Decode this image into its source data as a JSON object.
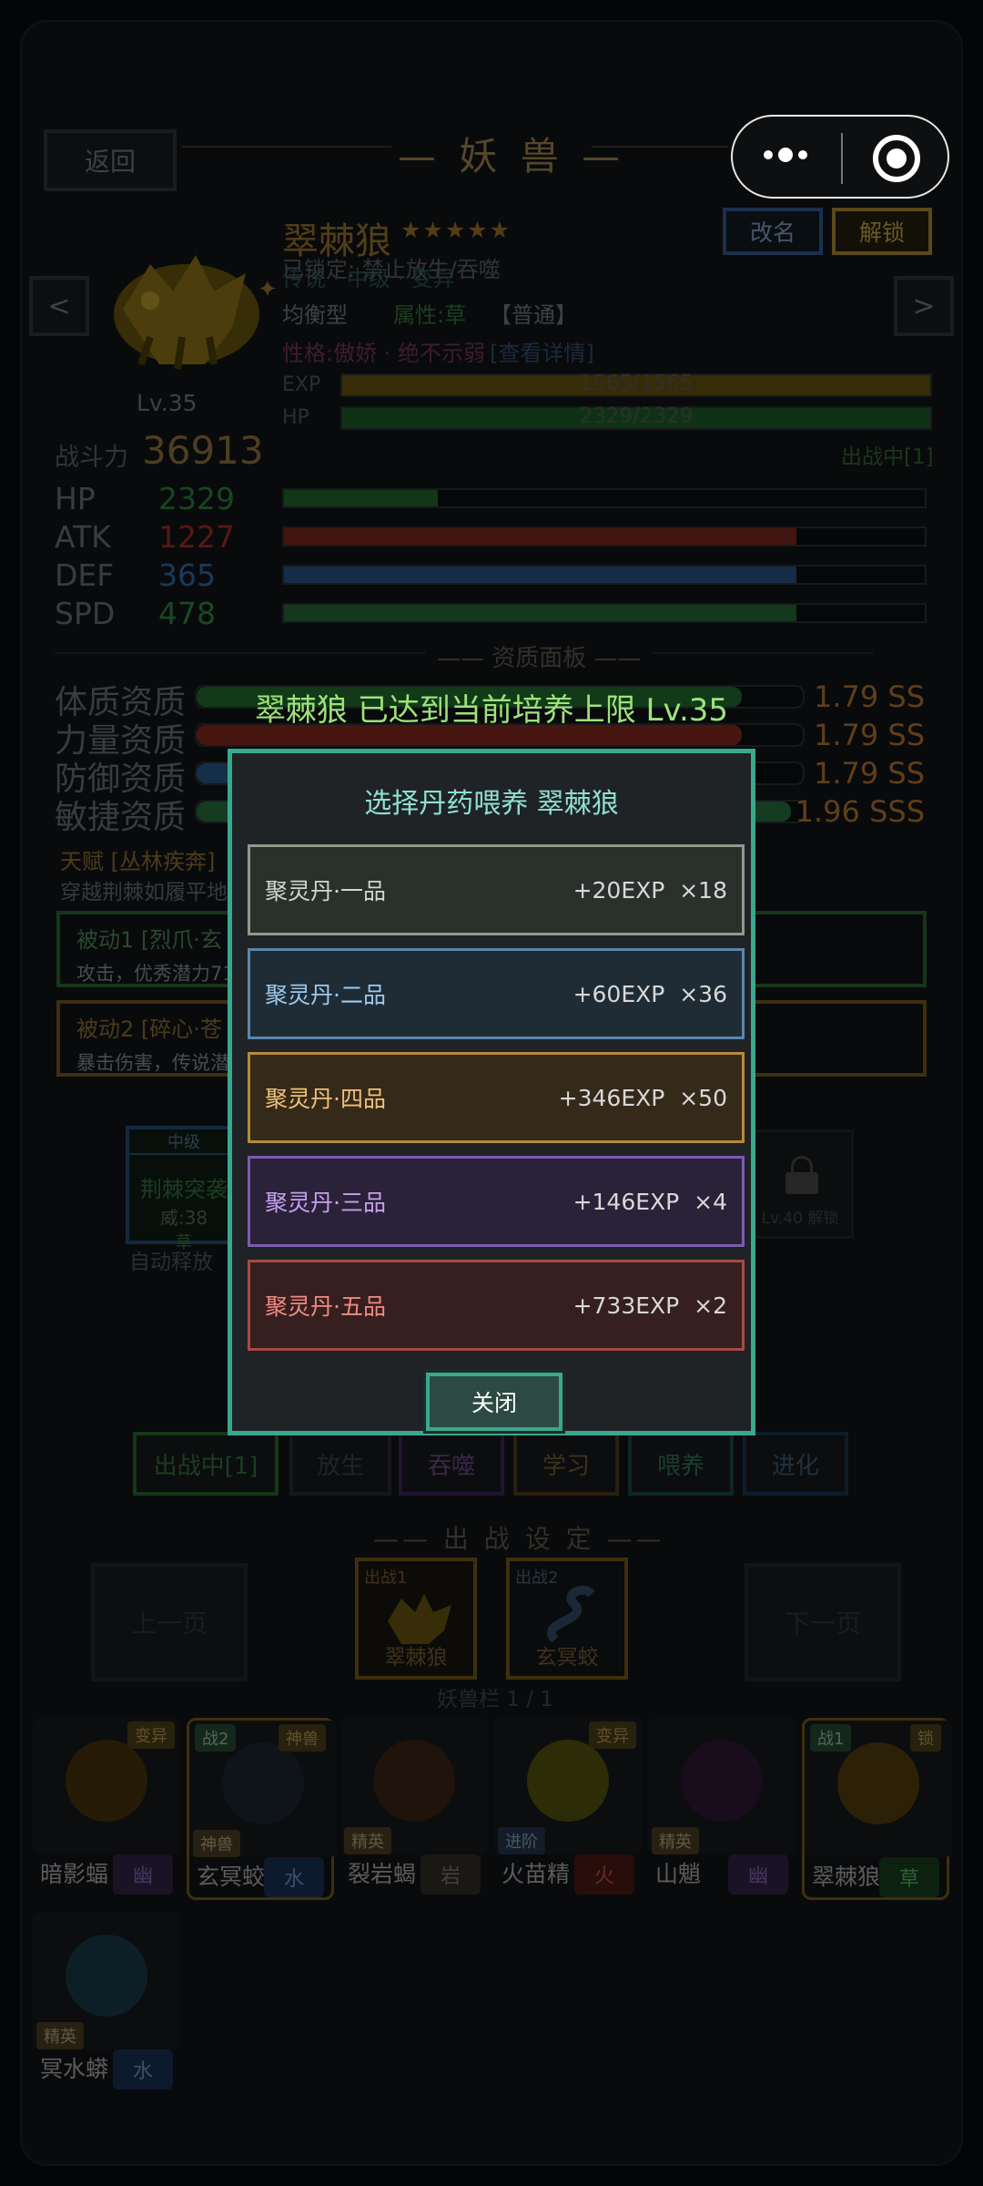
{
  "header": {
    "back_label": "返回",
    "title": "妖 兽"
  },
  "pet": {
    "name": "翠棘狼",
    "stars": "★★★★★",
    "level": "Lv.35",
    "locked_line": "已锁定: 禁止放生/吞噬",
    "rarity_line": "传说 · 中级 · 变异",
    "type": "均衡型",
    "attribute": "属性:草",
    "quality": "【普通】",
    "personality": "性格:傲娇 · 绝不示弱",
    "details_link": "[查看详情]",
    "rename_label": "改名",
    "unlock_label": "解锁",
    "exp_label": "EXP",
    "exp_text": "1565/1565",
    "exp_ratio": 1.0,
    "hp_label": "HP",
    "hp_text": "2329/2329",
    "hp_ratio": 1.0,
    "power_label": "战斗力",
    "power_value": "36913",
    "deploy_status": "出战中[1]"
  },
  "stats": [
    {
      "label": "HP",
      "value": "2329",
      "ratio": 0.24,
      "color": "#2f9e44"
    },
    {
      "label": "ATK",
      "value": "1227",
      "ratio": 0.8,
      "color": "#c0392b"
    },
    {
      "label": "DEF",
      "value": "365",
      "ratio": 0.8,
      "color": "#3a7ec8"
    },
    {
      "label": "SPD",
      "value": "478",
      "ratio": 0.8,
      "color": "#38a155"
    }
  ],
  "aptitude": {
    "title": "资质面板",
    "rows": [
      {
        "label": "体质资质",
        "value": "1.79 SS",
        "ratio": 0.9,
        "color": "#2f9e44"
      },
      {
        "label": "力量资质",
        "value": "1.79 SS",
        "ratio": 0.9,
        "color": "#c0392b"
      },
      {
        "label": "防御资质",
        "value": "1.79 SS",
        "ratio": 0.9,
        "color": "#3a7ec8"
      },
      {
        "label": "敏捷资质",
        "value": "1.96 SSS",
        "ratio": 0.98,
        "color": "#38a155"
      }
    ]
  },
  "talent": {
    "title": "天赋 [丛林疾奔]",
    "desc": "穿越荆棘如履平地"
  },
  "passives": [
    {
      "title": "被动1 [烈爪·玄",
      "desc": "攻击，优秀潜力71"
    },
    {
      "title": "被动2 [碎心·苍",
      "desc": "暴击伤害，传说潜"
    }
  ],
  "skills": {
    "active_tier": "中级",
    "active_name": "荆棘突袭",
    "active_power": "威:38",
    "active_extra": "草",
    "auto_cast": "自动释放",
    "locked_label": "Lv.40 解锁"
  },
  "actions": [
    "出战中[1]",
    "放生",
    "吞噬",
    "学习",
    "喂养",
    "进化"
  ],
  "deploy": {
    "title": "出 战 设 定",
    "prev_page": "上一页",
    "next_page": "下一页",
    "slot1_tag": "出战1",
    "slot1_name": "翠棘狼",
    "slot2_tag": "出战2",
    "slot2_name": "玄冥蛟",
    "page_text": "妖兽栏 1 / 1"
  },
  "roster": [
    {
      "name": "暗影蝠",
      "element": "幽",
      "tag": "变异",
      "rank": ""
    },
    {
      "name": "玄冥蛟",
      "element": "水",
      "tag": "神兽",
      "rank": "战2",
      "sub": "神兽"
    },
    {
      "name": "裂岩蝎",
      "element": "岩",
      "tag": "",
      "rank": "",
      "sub": "精英"
    },
    {
      "name": "火苗精",
      "element": "火",
      "tag": "变异",
      "rank": "",
      "sub": "进阶"
    },
    {
      "name": "山魈",
      "element": "幽",
      "tag": "",
      "rank": "",
      "sub": "精英"
    },
    {
      "name": "翠棘狼",
      "element": "草",
      "tag": "锁",
      "rank": "战1"
    },
    {
      "name": "冥水蟒",
      "element": "水",
      "tag": "",
      "rank": "",
      "sub": "精英"
    }
  ],
  "modal": {
    "banner": "翠棘狼 已达到当前培养上限 Lv.35",
    "title": "选择丹药喂养 翠棘狼",
    "options": [
      {
        "name": "聚灵丹·一品",
        "exp": "+20EXP",
        "count": "×18",
        "color": "#cfd7cf",
        "border": "#8f9a8f",
        "bg": "#2a302c"
      },
      {
        "name": "聚灵丹·二品",
        "exp": "+60EXP",
        "count": "×36",
        "color": "#9ec9ec",
        "border": "#5a86ad",
        "bg": "#1f2c36"
      },
      {
        "name": "聚灵丹·四品",
        "exp": "+346EXP",
        "count": "×50",
        "color": "#f0c277",
        "border": "#b68a3a",
        "bg": "#35291a"
      },
      {
        "name": "聚灵丹·三品",
        "exp": "+146EXP",
        "count": "×4",
        "color": "#c7a0f0",
        "border": "#7c5bb0",
        "bg": "#2a2238"
      },
      {
        "name": "聚灵丹·五品",
        "exp": "+733EXP",
        "count": "×2",
        "color": "#f08a82",
        "border": "#a64a45",
        "bg": "#361f1f"
      }
    ],
    "close_label": "关闭"
  }
}
